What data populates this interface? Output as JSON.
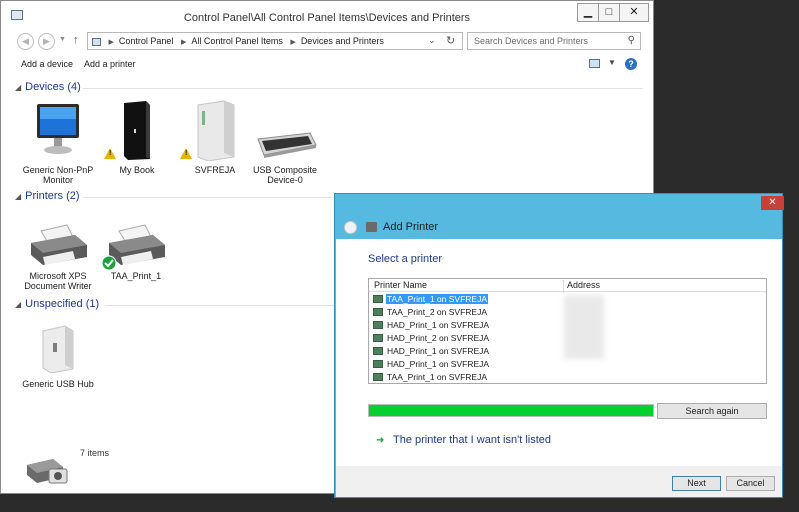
{
  "window": {
    "title": "Control Panel\\All Control Panel Items\\Devices and Printers",
    "minimize": "▁",
    "maximize": "□",
    "close": "✕"
  },
  "nav": {
    "breadcrumbs": [
      "Control Panel",
      "All Control Panel Items",
      "Devices and Printers"
    ],
    "search_placeholder": "Search Devices and Printers"
  },
  "toolbar": {
    "add_device": "Add a device",
    "add_printer": "Add a printer"
  },
  "groups": {
    "devices": "Devices (4)",
    "printers": "Printers (2)",
    "unspecified": "Unspecified (1)"
  },
  "devices": [
    {
      "label": "Generic Non-PnP Monitor",
      "icon": "monitor-icon"
    },
    {
      "label": "My Book",
      "icon": "external-drive-icon",
      "warning": true
    },
    {
      "label": "SVFREJA",
      "icon": "computer-icon",
      "warning": true
    },
    {
      "label": "USB Composite Device-0",
      "icon": "keyboard-icon"
    }
  ],
  "printers": [
    {
      "label": "Microsoft XPS Document Writer",
      "icon": "printer-icon"
    },
    {
      "label": "TAA_Print_1",
      "icon": "printer-icon",
      "default": true
    }
  ],
  "unspecified": [
    {
      "label": "Generic USB Hub",
      "icon": "usb-hub-icon"
    }
  ],
  "status": {
    "items": "7 items"
  },
  "dialog": {
    "title": "Add Printer",
    "close": "✕",
    "heading": "Select a printer",
    "columns": {
      "name": "Printer Name",
      "address": "Address"
    },
    "printers": [
      {
        "name": "TAA_Print_1 on SVFREJA",
        "selected": true
      },
      {
        "name": "TAA_Print_2 on SVFREJA"
      },
      {
        "name": "HAD_Print_1 on SVFREJA"
      },
      {
        "name": "HAD_Print_2 on SVFREJA"
      },
      {
        "name": "HAD_Print_1 on SVFREJA"
      },
      {
        "name": "HAD_Print_1 on SVFREJA"
      },
      {
        "name": "TAA_Print_1 on SVFREJA"
      }
    ],
    "search_progress": 1.0,
    "search_again": "Search again",
    "not_listed": "The printer that I want isn't listed",
    "next": "Next",
    "cancel": "Cancel"
  },
  "colors": {
    "dialog_frame": "#56b9e0",
    "progress": "#06d02f",
    "link": "#1e3a8a",
    "selection": "#3399ff"
  }
}
